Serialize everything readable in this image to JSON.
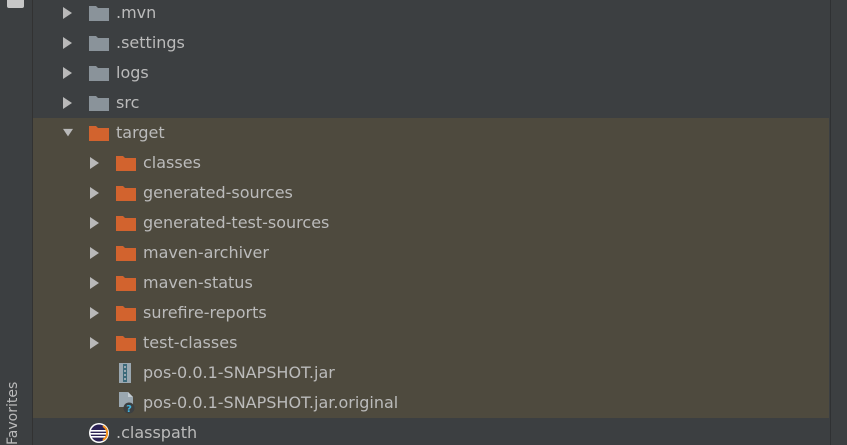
{
  "sidebar": {
    "favorites_label": "Favorites"
  },
  "tree": {
    "items": [
      {
        "label": ".mvn",
        "icon": "folder-gray-icon",
        "arrow": "collapsed",
        "highlighted": false
      },
      {
        "label": ".settings",
        "icon": "folder-gray-icon",
        "arrow": "collapsed",
        "highlighted": false
      },
      {
        "label": "logs",
        "icon": "folder-gray-icon",
        "arrow": "collapsed",
        "highlighted": false
      },
      {
        "label": "src",
        "icon": "folder-gray-icon",
        "arrow": "collapsed",
        "highlighted": false
      },
      {
        "label": "target",
        "icon": "folder-orange-icon",
        "arrow": "expanded",
        "highlighted": true
      },
      {
        "label": "classes",
        "icon": "folder-orange-icon",
        "arrow": "collapsed",
        "highlighted": true
      },
      {
        "label": "generated-sources",
        "icon": "folder-orange-icon",
        "arrow": "collapsed",
        "highlighted": true
      },
      {
        "label": "generated-test-sources",
        "icon": "folder-orange-icon",
        "arrow": "collapsed",
        "highlighted": true
      },
      {
        "label": "maven-archiver",
        "icon": "folder-orange-icon",
        "arrow": "collapsed",
        "highlighted": true
      },
      {
        "label": "maven-status",
        "icon": "folder-orange-icon",
        "arrow": "collapsed",
        "highlighted": true
      },
      {
        "label": "surefire-reports",
        "icon": "folder-orange-icon",
        "arrow": "collapsed",
        "highlighted": true
      },
      {
        "label": "test-classes",
        "icon": "folder-orange-icon",
        "arrow": "collapsed",
        "highlighted": true
      },
      {
        "label": "pos-0.0.1-SNAPSHOT.jar",
        "icon": "jar-archive-icon",
        "arrow": "none",
        "highlighted": true
      },
      {
        "label": "pos-0.0.1-SNAPSHOT.jar.original",
        "icon": "unknown-file-icon",
        "arrow": "none",
        "highlighted": true
      },
      {
        "label": ".classpath",
        "icon": "eclipse-classpath-icon",
        "arrow": "none",
        "highlighted": false
      }
    ]
  },
  "colors": {
    "background": "#3c3f41",
    "excluded_highlight": "#4e4a3e",
    "folder_gray": "#8a939a",
    "folder_orange": "#d2632e",
    "text": "#bbbbbb"
  }
}
